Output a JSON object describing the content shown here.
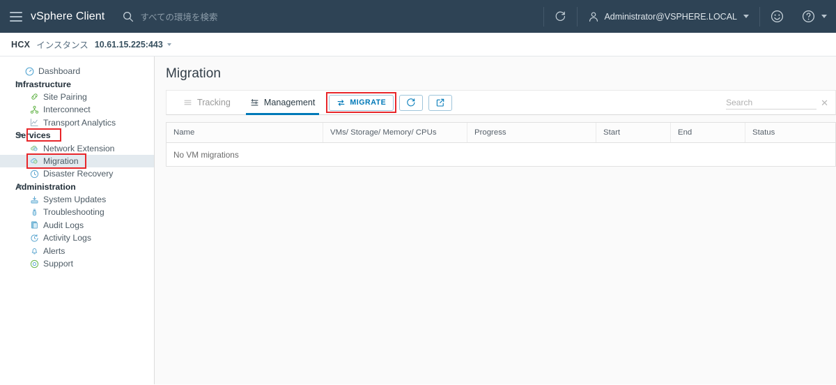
{
  "header": {
    "menu_icon": "hamburger-icon",
    "brand": "vSphere Client",
    "search_icon": "search-icon",
    "search_placeholder": "すべての環境を検索",
    "refresh_icon": "refresh-icon",
    "user_icon": "user-icon",
    "user": "Administrator@VSPHERE.LOCAL",
    "feedback_icon": "smiley-icon",
    "help_icon": "help-icon",
    "bg_color": "#2e4355"
  },
  "breadcrumb": {
    "app": "HCX",
    "instance_label": "インスタンス",
    "instance_value": "10.61.15.225:443"
  },
  "sidebar": {
    "items": [
      {
        "label": "Dashboard",
        "icon": "dashboard-gauge-icon",
        "type": "child-top",
        "name": "sidebar-item-dashboard"
      },
      {
        "label": "Infrastructure",
        "icon": "chevron-down-icon",
        "type": "group",
        "name": "sidebar-group-infrastructure"
      },
      {
        "label": "Site Pairing",
        "icon": "site-pairing-icon",
        "type": "child",
        "name": "sidebar-item-site-pairing"
      },
      {
        "label": "Interconnect",
        "icon": "interconnect-icon",
        "type": "child",
        "name": "sidebar-item-interconnect"
      },
      {
        "label": "Transport Analytics",
        "icon": "transport-analytics-icon",
        "type": "child",
        "name": "sidebar-item-transport-analytics"
      },
      {
        "label": "Services",
        "icon": "chevron-down-icon",
        "type": "group",
        "name": "sidebar-group-services",
        "highlighted": true
      },
      {
        "label": "Network Extension",
        "icon": "network-extension-icon",
        "type": "child",
        "name": "sidebar-item-network-extension"
      },
      {
        "label": "Migration",
        "icon": "migration-icon",
        "type": "child",
        "name": "sidebar-item-migration",
        "selected": true,
        "highlighted": true
      },
      {
        "label": "Disaster Recovery",
        "icon": "disaster-recovery-icon",
        "type": "child",
        "name": "sidebar-item-disaster-recovery"
      },
      {
        "label": "Administration",
        "icon": "chevron-down-icon",
        "type": "group",
        "name": "sidebar-group-administration"
      },
      {
        "label": "System Updates",
        "icon": "system-updates-icon",
        "type": "child",
        "name": "sidebar-item-system-updates"
      },
      {
        "label": "Troubleshooting",
        "icon": "troubleshooting-icon",
        "type": "child",
        "name": "sidebar-item-troubleshooting"
      },
      {
        "label": "Audit Logs",
        "icon": "audit-logs-icon",
        "type": "child",
        "name": "sidebar-item-audit-logs"
      },
      {
        "label": "Activity Logs",
        "icon": "activity-logs-icon",
        "type": "child",
        "name": "sidebar-item-activity-logs"
      },
      {
        "label": "Alerts",
        "icon": "bell-icon",
        "type": "child",
        "name": "sidebar-item-alerts"
      },
      {
        "label": "Support",
        "icon": "support-icon",
        "type": "child",
        "name": "sidebar-item-support"
      }
    ]
  },
  "main": {
    "title": "Migration",
    "tabs": [
      {
        "label": "Tracking",
        "icon": "list-icon",
        "active": false
      },
      {
        "label": "Management",
        "icon": "filter-list-icon",
        "active": true
      }
    ],
    "buttons": {
      "migrate": "MIGRATE",
      "migrate_icon": "migrate-arrows-icon",
      "refresh_icon": "refresh-icon",
      "export_icon": "external-link-icon"
    },
    "search": {
      "placeholder": "Search",
      "value": "",
      "clear_icon": "close-icon"
    },
    "table": {
      "columns": [
        "Name",
        "VMs/ Storage/ Memory/ CPUs",
        "Progress",
        "Start",
        "End",
        "Status"
      ],
      "rows": [],
      "empty_message": "No VM migrations"
    }
  },
  "colors": {
    "accent": "#0079b8",
    "highlight_red": "#e8262a",
    "header_bg": "#2e4355",
    "selected_row": "#e3eaef"
  }
}
